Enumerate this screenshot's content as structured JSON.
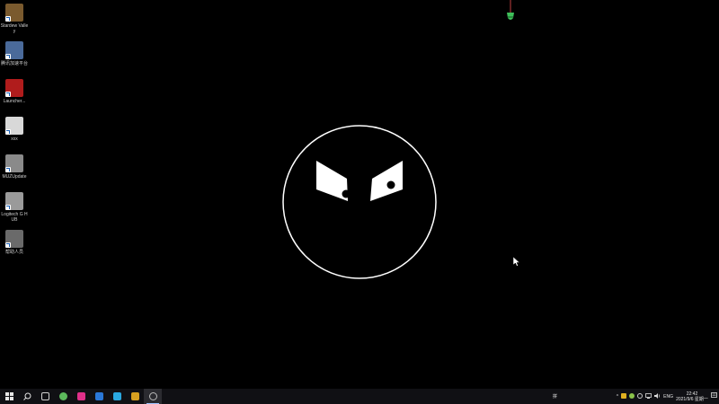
{
  "desktop_icons": [
    {
      "label": "Stardew Valley",
      "color": "#7a5a2e"
    },
    {
      "label": "腾讯加速平台",
      "color": "#4a6a9a"
    },
    {
      "label": "Launcher...",
      "color": "#b01c1c"
    },
    {
      "label": "xxx",
      "color": "#d8d8d8"
    },
    {
      "label": "MUZUpdate",
      "color": "#8a8a8a"
    },
    {
      "label": "Logitech G HUB",
      "color": "#9a9a9a"
    },
    {
      "label": "帮助人员",
      "color": "#6a6a6a"
    }
  ],
  "taskbar": {
    "start_icon": "windows-logo-icon",
    "search_icon": "search-icon",
    "apps": [
      {
        "name": "task-view-icon",
        "color": "#d0d0d0"
      },
      {
        "name": "green-app-icon",
        "color": "#5cb85c"
      },
      {
        "name": "pink-app-icon",
        "color": "#e0308a"
      },
      {
        "name": "blue-app-icon",
        "color": "#2a78d8"
      },
      {
        "name": "cyan-app-icon",
        "color": "#2aa8e0"
      },
      {
        "name": "yellow-app-icon",
        "color": "#d8a020"
      },
      {
        "name": "settings-app-icon",
        "color": "#bbbbbb"
      }
    ],
    "ime_short": "拼",
    "tray_lang": "ENG",
    "clock_time": "22:42",
    "clock_date": "2021/9/6 星期一"
  },
  "colors": {
    "background": "#000000",
    "face_stroke": "#ffffff",
    "taskbar": "#101014"
  }
}
